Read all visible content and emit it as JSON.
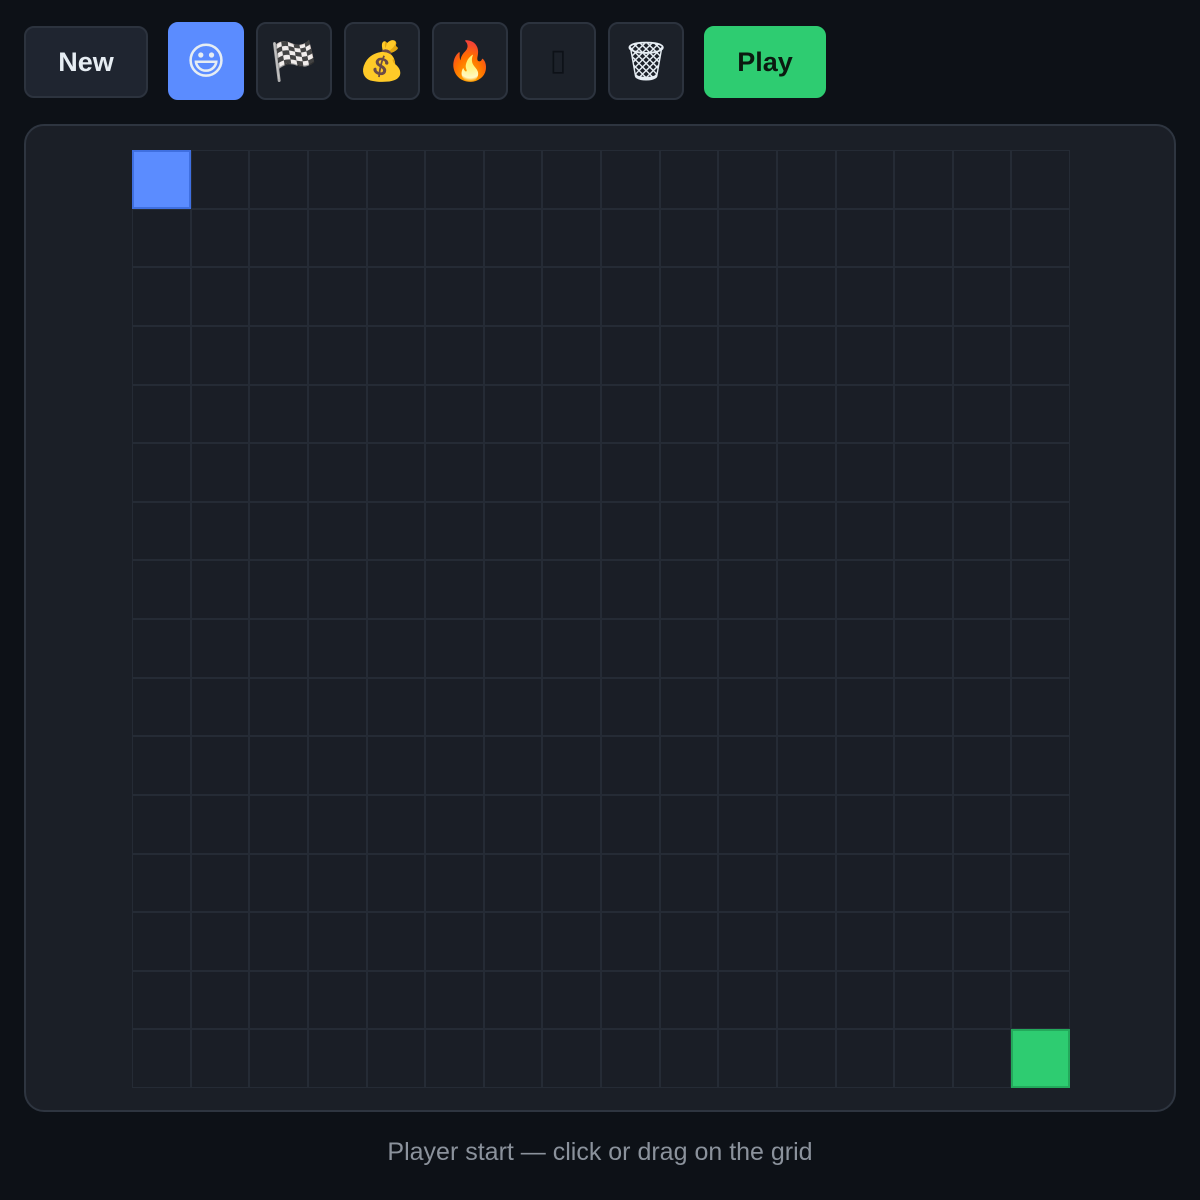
{
  "toolbar": {
    "new_label": "New",
    "play_label": "Play",
    "tools": [
      {
        "id": "player",
        "icon": "smiley-face-icon",
        "glyph": "😃",
        "selected": true
      },
      {
        "id": "goal",
        "icon": "checkered-flag-icon",
        "glyph": "🏁",
        "selected": false
      },
      {
        "id": "coin",
        "icon": "money-bag-icon",
        "glyph": "💰",
        "selected": false
      },
      {
        "id": "fire",
        "icon": "fire-icon",
        "glyph": "🔥",
        "selected": false
      },
      {
        "id": "wall",
        "icon": "wall-block-icon",
        "glyph": "▯",
        "selected": false
      },
      {
        "id": "erase",
        "icon": "trash-can-icon",
        "glyph": "🗑",
        "selected": false
      }
    ]
  },
  "grid": {
    "rows": 16,
    "cols": 16,
    "player": {
      "row": 0,
      "col": 0
    },
    "goal": {
      "row": 15,
      "col": 15
    }
  },
  "colors": {
    "selected_tool": "#5b8cff",
    "player_cell": "#5b8cff",
    "goal_cell": "#2ecc71",
    "play_button": "#2ecc71"
  },
  "status": {
    "text": "Player start — click or drag on the grid"
  }
}
